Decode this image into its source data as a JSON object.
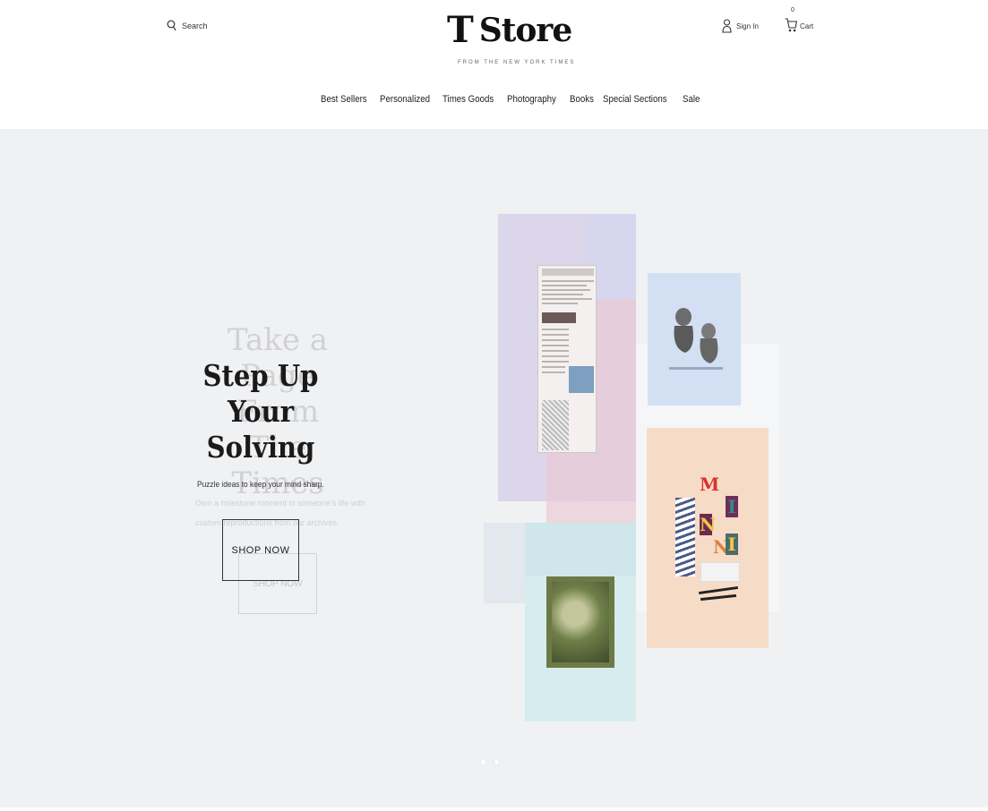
{
  "header": {
    "search_label": "Search",
    "logo_mark": "T",
    "logo_word": "Store",
    "tagline": "FROM THE NEW YORK TIMES",
    "signin_label": "Sign In",
    "cart_count": "0",
    "cart_label": "Cart"
  },
  "nav": {
    "items": [
      "Best Sellers",
      "Personalized",
      "Times Goods",
      "Photography",
      "Books",
      "Special Sections",
      "Sale"
    ]
  },
  "hero": {
    "title": "Step Up Your Solving",
    "subtitle": "Puzzle ideas to keep your mind sharp.",
    "button_label": "SHOP NOW",
    "ghost_title": "Take a Page From The Times",
    "ghost_subtitle": "Own a milestone moment in someone's life with custom reproductions from our archives.",
    "ghost_button_label": "SHOP NOW",
    "tiles": [
      "M",
      "I",
      "N",
      "N",
      "I"
    ],
    "carousel_dots": 2,
    "active_dot": 1
  },
  "colors": {
    "hero_bg": "#f0f1f3",
    "purple_panel": "#dcd6ea",
    "blue_panel": "#d3e0f3",
    "peach_panel": "#f6dcc6",
    "teal_panel": "#d6ecee",
    "pink_panel": "#ecc8d2"
  }
}
